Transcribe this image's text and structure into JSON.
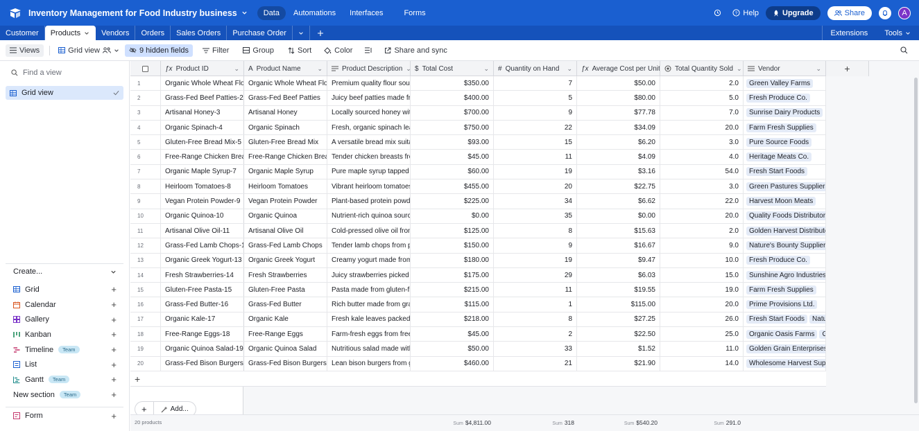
{
  "app": {
    "base_title": "Inventory Management for Food Industry business",
    "nav": [
      "Data",
      "Automations",
      "Interfaces",
      "Forms"
    ],
    "help_label": "Help",
    "upgrade_label": "Upgrade",
    "share_label": "Share",
    "avatar_initial": "A"
  },
  "tabs": {
    "items": [
      "Customer",
      "Products",
      "Vendors",
      "Orders",
      "Sales Orders",
      "Purchase Order"
    ],
    "active": "Products",
    "extensions_label": "Extensions",
    "tools_label": "Tools"
  },
  "toolbar": {
    "views_label": "Views",
    "grid_view_label": "Grid view",
    "hidden_fields_label": "9 hidden fields",
    "filter_label": "Filter",
    "group_label": "Group",
    "sort_label": "Sort",
    "color_label": "Color",
    "share_sync_label": "Share and sync"
  },
  "sidebar": {
    "find_placeholder": "Find a view",
    "active_view": "Grid view",
    "create_label": "Create...",
    "create_items": [
      {
        "label": "Grid",
        "team": false
      },
      {
        "label": "Calendar",
        "team": false
      },
      {
        "label": "Gallery",
        "team": false
      },
      {
        "label": "Kanban",
        "team": false
      },
      {
        "label": "Timeline",
        "team": true
      },
      {
        "label": "List",
        "team": false
      },
      {
        "label": "Gantt",
        "team": true
      },
      {
        "label": "New section",
        "team": true
      }
    ],
    "team_label": "Team",
    "form_label": "Form"
  },
  "grid": {
    "columns": [
      "Product ID",
      "Product Name",
      "Product Description",
      "Total Cost",
      "Quantity on Hand",
      "Average Cost per Unit",
      "Total Quantity Sold",
      "Vendor"
    ],
    "rows": [
      {
        "n": "1",
        "id": "Organic Whole Wheat Flou...",
        "name": "Organic Whole Wheat Flour",
        "desc": "Premium quality flour sour...",
        "cost": "$350.00",
        "qty": "7",
        "avg": "$50.00",
        "sold": "2.0",
        "vendor": [
          "Green Valley Farms"
        ]
      },
      {
        "n": "2",
        "id": "Grass-Fed Beef Patties-2",
        "name": "Grass-Fed Beef Patties",
        "desc": "Juicy beef patties made fro...",
        "cost": "$400.00",
        "qty": "5",
        "avg": "$80.00",
        "sold": "5.0",
        "vendor": [
          "Fresh Produce Co."
        ]
      },
      {
        "n": "3",
        "id": "Artisanal Honey-3",
        "name": "Artisanal Honey",
        "desc": "Locally sourced honey with...",
        "cost": "$700.00",
        "qty": "9",
        "avg": "$77.78",
        "sold": "7.0",
        "vendor": [
          "Sunrise Dairy Products"
        ]
      },
      {
        "n": "4",
        "id": "Organic Spinach-4",
        "name": "Organic Spinach",
        "desc": "Fresh, organic spinach leav...",
        "cost": "$750.00",
        "qty": "22",
        "avg": "$34.09",
        "sold": "20.0",
        "vendor": [
          "Farm Fresh Supplies"
        ]
      },
      {
        "n": "5",
        "id": "Gluten-Free Bread Mix-5",
        "name": "Gluten-Free Bread Mix",
        "desc": "A versatile bread mix suita...",
        "cost": "$93.00",
        "qty": "15",
        "avg": "$6.20",
        "sold": "3.0",
        "vendor": [
          "Pure Source Foods"
        ]
      },
      {
        "n": "6",
        "id": "Free-Range Chicken Breast...",
        "name": "Free-Range Chicken Breasts",
        "desc": "Tender chicken breasts fro...",
        "cost": "$45.00",
        "qty": "11",
        "avg": "$4.09",
        "sold": "4.0",
        "vendor": [
          "Heritage Meats Co."
        ]
      },
      {
        "n": "7",
        "id": "Organic Maple Syrup-7",
        "name": "Organic Maple Syrup",
        "desc": "Pure maple syrup tapped fr...",
        "cost": "$60.00",
        "qty": "19",
        "avg": "$3.16",
        "sold": "54.0",
        "vendor": [
          "Fresh Start Foods"
        ]
      },
      {
        "n": "8",
        "id": "Heirloom Tomatoes-8",
        "name": "Heirloom Tomatoes",
        "desc": "Vibrant heirloom tomatoes...",
        "cost": "$455.00",
        "qty": "20",
        "avg": "$22.75",
        "sold": "3.0",
        "vendor": [
          "Green Pastures Suppliers"
        ]
      },
      {
        "n": "9",
        "id": "Vegan Protein Powder-9",
        "name": "Vegan Protein Powder",
        "desc": "Plant-based protein powde...",
        "cost": "$225.00",
        "qty": "34",
        "avg": "$6.62",
        "sold": "22.0",
        "vendor": [
          "Harvest Moon Meats"
        ]
      },
      {
        "n": "10",
        "id": "Organic Quinoa-10",
        "name": "Organic Quinoa",
        "desc": "Nutrient-rich quinoa sourc...",
        "cost": "$0.00",
        "qty": "35",
        "avg": "$0.00",
        "sold": "20.0",
        "vendor": [
          "Quality Foods Distributors"
        ]
      },
      {
        "n": "11",
        "id": "Artisanal Olive Oil-11",
        "name": "Artisanal Olive Oil",
        "desc": "Cold-pressed olive oil from...",
        "cost": "$125.00",
        "qty": "8",
        "avg": "$15.63",
        "sold": "2.0",
        "vendor": [
          "Golden Harvest Distributors"
        ]
      },
      {
        "n": "12",
        "id": "Grass-Fed Lamb Chops-12",
        "name": "Grass-Fed Lamb Chops",
        "desc": "Tender lamb chops from p...",
        "cost": "$150.00",
        "qty": "9",
        "avg": "$16.67",
        "sold": "9.0",
        "vendor": [
          "Nature's Bounty Suppliers"
        ]
      },
      {
        "n": "13",
        "id": "Organic Greek Yogurt-13",
        "name": "Organic Greek Yogurt",
        "desc": "Creamy yogurt made from ...",
        "cost": "$180.00",
        "qty": "19",
        "avg": "$9.47",
        "sold": "10.0",
        "vendor": [
          "Fresh Produce Co."
        ]
      },
      {
        "n": "14",
        "id": "Fresh Strawberries-14",
        "name": "Fresh Strawberries",
        "desc": "Juicy strawberries picked at...",
        "cost": "$175.00",
        "qty": "29",
        "avg": "$6.03",
        "sold": "15.0",
        "vendor": [
          "Sunshine Agro Industries"
        ]
      },
      {
        "n": "15",
        "id": "Gluten-Free Pasta-15",
        "name": "Gluten-Free Pasta",
        "desc": "Pasta made from gluten-fr...",
        "cost": "$215.00",
        "qty": "11",
        "avg": "$19.55",
        "sold": "19.0",
        "vendor": [
          "Farm Fresh Supplies"
        ]
      },
      {
        "n": "16",
        "id": "Grass-Fed Butter-16",
        "name": "Grass-Fed Butter",
        "desc": "Rich butter made from gra...",
        "cost": "$115.00",
        "qty": "1",
        "avg": "$115.00",
        "sold": "20.0",
        "vendor": [
          "Prime Provisions Ltd."
        ]
      },
      {
        "n": "17",
        "id": "Organic Kale-17",
        "name": "Organic Kale",
        "desc": "Fresh kale leaves packed wi...",
        "cost": "$218.00",
        "qty": "8",
        "avg": "$27.25",
        "sold": "26.0",
        "vendor": [
          "Fresh Start Foods",
          "Natural De"
        ]
      },
      {
        "n": "18",
        "id": "Free-Range Eggs-18",
        "name": "Free-Range Eggs",
        "desc": "Farm-fresh eggs from free-...",
        "cost": "$45.00",
        "qty": "2",
        "avg": "$22.50",
        "sold": "25.0",
        "vendor": [
          "Organic Oasis Farms",
          "Gourm"
        ]
      },
      {
        "n": "19",
        "id": "Organic Quinoa Salad-19",
        "name": "Organic Quinoa Salad",
        "desc": "Nutritious salad made with...",
        "cost": "$50.00",
        "qty": "33",
        "avg": "$1.52",
        "sold": "11.0",
        "vendor": [
          "Golden Grain Enterprises"
        ]
      },
      {
        "n": "20",
        "id": "Grass-Fed Bison Burgers-20",
        "name": "Grass-Fed Bison Burgers",
        "desc": "Lean bison burgers from gr...",
        "cost": "$460.00",
        "qty": "21",
        "avg": "$21.90",
        "sold": "14.0",
        "vendor": [
          "Wholesome Harvest Supplier"
        ]
      }
    ],
    "add_label": "Add...",
    "record_count": "20 products",
    "sum_label": "Sum",
    "sum_cost": "$4,811.00",
    "sum_qty": "318",
    "sum_avg": "$540.20",
    "sum_sold": "291.0"
  },
  "colors": {
    "topbar": "#1a5fd0",
    "tabbar": "#1552bb",
    "accent": "#1a5fd0",
    "vendor_pill": "#e4ebf7"
  }
}
